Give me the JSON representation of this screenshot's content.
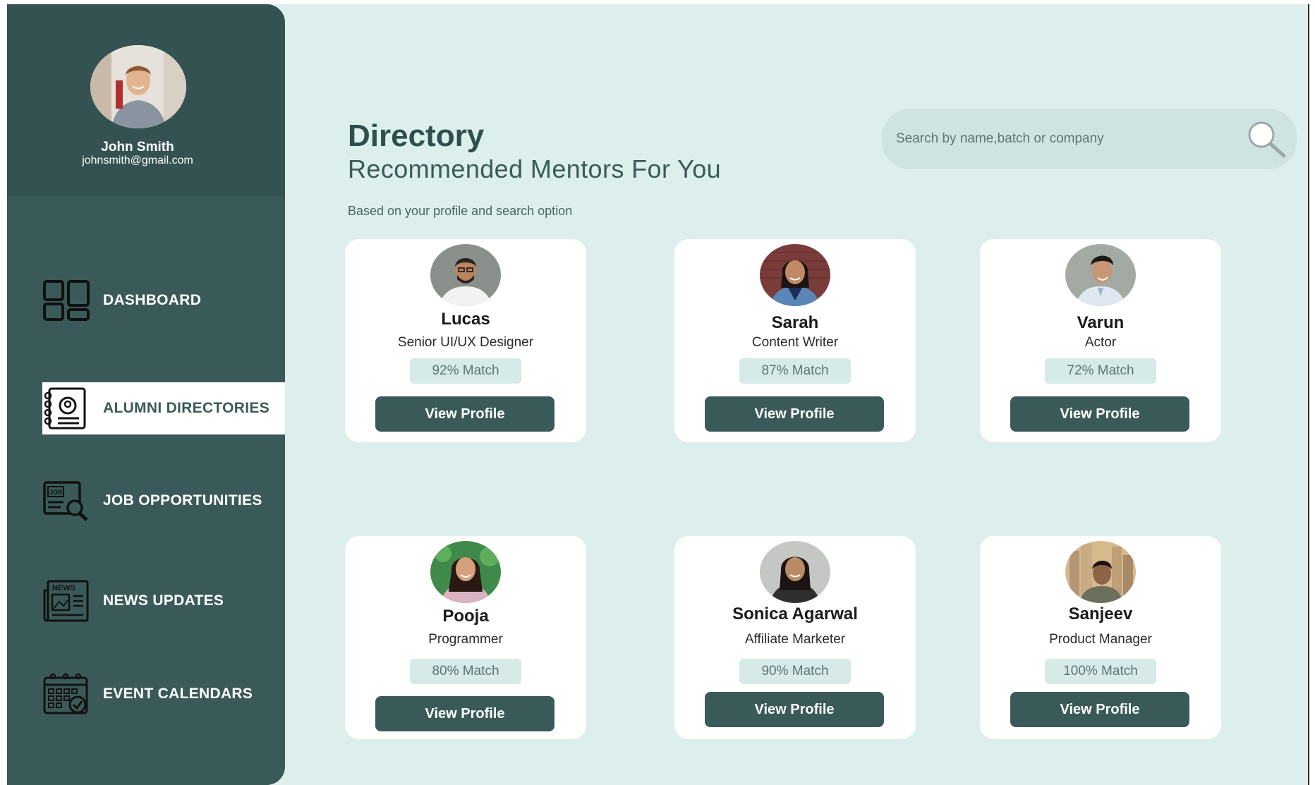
{
  "user": {
    "name": "John Smith",
    "email": "johnsmith@gmail.com",
    "avatar_icon": "user-avatar"
  },
  "sidebar": {
    "items": [
      {
        "label": "DASHBOARD",
        "icon": "dashboard-grid-icon"
      },
      {
        "label": "ALUMNI DIRECTORIES",
        "icon": "directory-book-icon",
        "active": true
      },
      {
        "label": "JOB OPPORTUNITIES",
        "icon": "job-search-icon"
      },
      {
        "label": "NEWS UPDATES",
        "icon": "newspaper-icon"
      },
      {
        "label": "EVENT CALENDARS",
        "icon": "calendar-check-icon"
      }
    ]
  },
  "main": {
    "title": "Directory",
    "subtitle": "Recommended Mentors For You",
    "hint": "Based on your profile and search option",
    "search": {
      "placeholder": "Search by name,batch or company",
      "icon": "search-icon"
    }
  },
  "mentors": [
    {
      "name": "Lucas",
      "role": "Senior UI/UX Designer",
      "match": "92% Match",
      "button": "View Profile"
    },
    {
      "name": "Sarah",
      "role": "Content Writer",
      "match": "87% Match",
      "button": "View Profile"
    },
    {
      "name": "Varun",
      "role": "Actor",
      "match": "72% Match",
      "button": "View Profile"
    },
    {
      "name": "Pooja",
      "role": "Programmer",
      "match": "80% Match",
      "button": "View Profile"
    },
    {
      "name": "Sonica Agarwal",
      "role": "Affiliate Marketer",
      "match": "90% Match",
      "button": "View Profile"
    },
    {
      "name": "Sanjeev",
      "role": "Product Manager",
      "match": "100% Match",
      "button": "View Profile"
    }
  ],
  "colors": {
    "sidebar": "#3a5a59",
    "background": "#dcefed",
    "accent": "#3a5a59",
    "card": "#ffffff"
  }
}
